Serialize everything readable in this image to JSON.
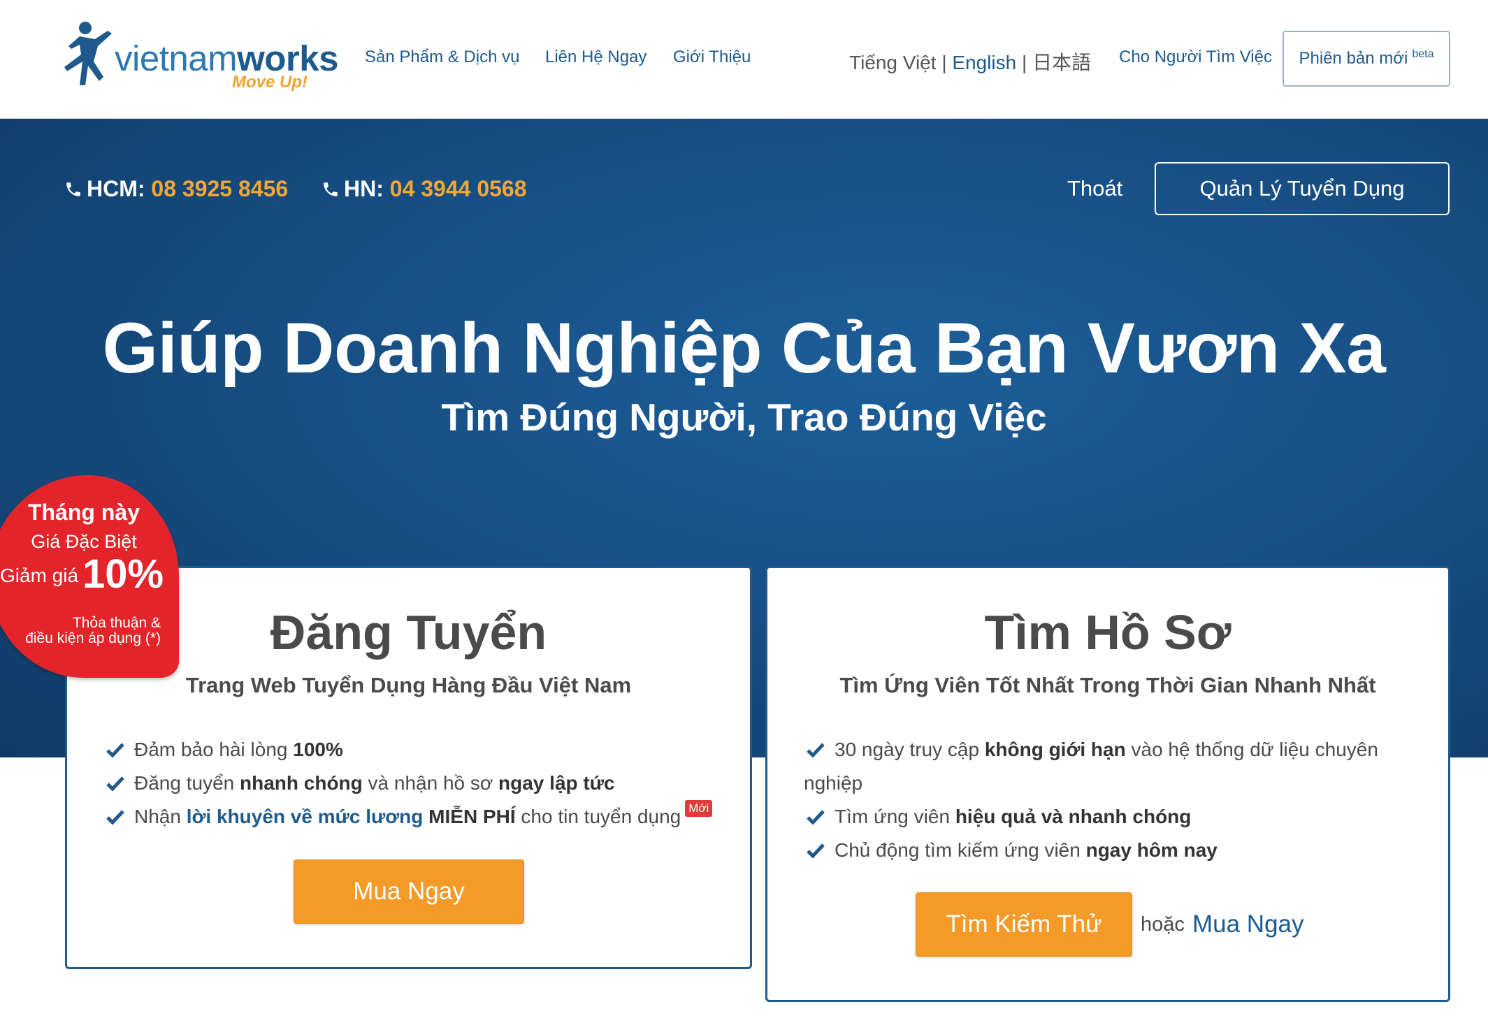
{
  "topnav": {
    "logo": {
      "word_light": "vietnam",
      "word_bold": "works",
      "tagline": "Move Up!"
    },
    "links": [
      "Sản Phẩm & Dịch vụ",
      "Liên Hệ Ngay",
      "Giới Thiệu"
    ],
    "languages": {
      "vi": "Tiếng Việt",
      "en": "English",
      "ja": "日本語"
    },
    "job_seeker_link": "Cho Người Tìm Việc",
    "new_version": {
      "label": "Phiên bản mới",
      "sup": "beta"
    }
  },
  "hero": {
    "hcm_label": "HCM:",
    "hcm_number": "08 3925 8456",
    "hn_label": "HN:",
    "hn_number": "04 3944 0568",
    "logout": "Thoát",
    "manage_button": "Quản Lý Tuyển Dụng",
    "title": "Giúp Doanh Nghiệp Của Bạn Vươn Xa",
    "subtitle": "Tìm Đúng Người, Trao Đúng Việc"
  },
  "promo": {
    "line1": "Tháng này",
    "line2": "Giá Đặc Biệt",
    "discount_label": "Giảm giá",
    "discount_value": "10%",
    "note1": "Thỏa thuận &",
    "note2": "điều kiện áp dụng (*)"
  },
  "post_job": {
    "title": "Đăng Tuyển",
    "subtitle": "Trang Web Tuyển Dụng Hàng Đầu Việt Nam",
    "f1_a": "Đảm bảo hài lòng ",
    "f1_b": "100%",
    "f2_a": "Đăng tuyển ",
    "f2_b": "nhanh chóng",
    "f2_c": " và nhận hồ sơ ",
    "f2_d": "ngay lập tức",
    "f3_a": "Nhận ",
    "f3_b": "lời khuyên về mức lương",
    "f3_c": " MIỄN PHÍ",
    "f3_d": " cho tin tuyển dụng",
    "new_badge": "Mới",
    "buy_button": "Mua Ngay"
  },
  "find_cv": {
    "title": "Tìm Hồ Sơ",
    "subtitle": "Tìm Ứng Viên Tốt Nhất Trong Thời Gian Nhanh Nhất",
    "f1_a": "30 ngày truy cập ",
    "f1_b": "không giới hạn",
    "f1_c": " vào hệ thống dữ liệu chuyên",
    "f1_d": "nghiệp",
    "f2_a": "Tìm ứng viên ",
    "f2_b": "hiệu quả và nhanh chóng",
    "f3_a": "Chủ động tìm kiếm ứng viên ",
    "f3_b": "ngay hôm nay",
    "try_button": "Tìm Kiếm Thử",
    "or_text": "hoặc",
    "buy_link": "Mua Ngay"
  },
  "colors": {
    "brand_blue": "#1e5a8c",
    "hero_blue": "#174f84",
    "accent_orange": "#f39a29",
    "promo_red": "#e3252b"
  },
  "icons": [
    "phone-icon",
    "check-icon",
    "logo-runner-icon"
  ]
}
